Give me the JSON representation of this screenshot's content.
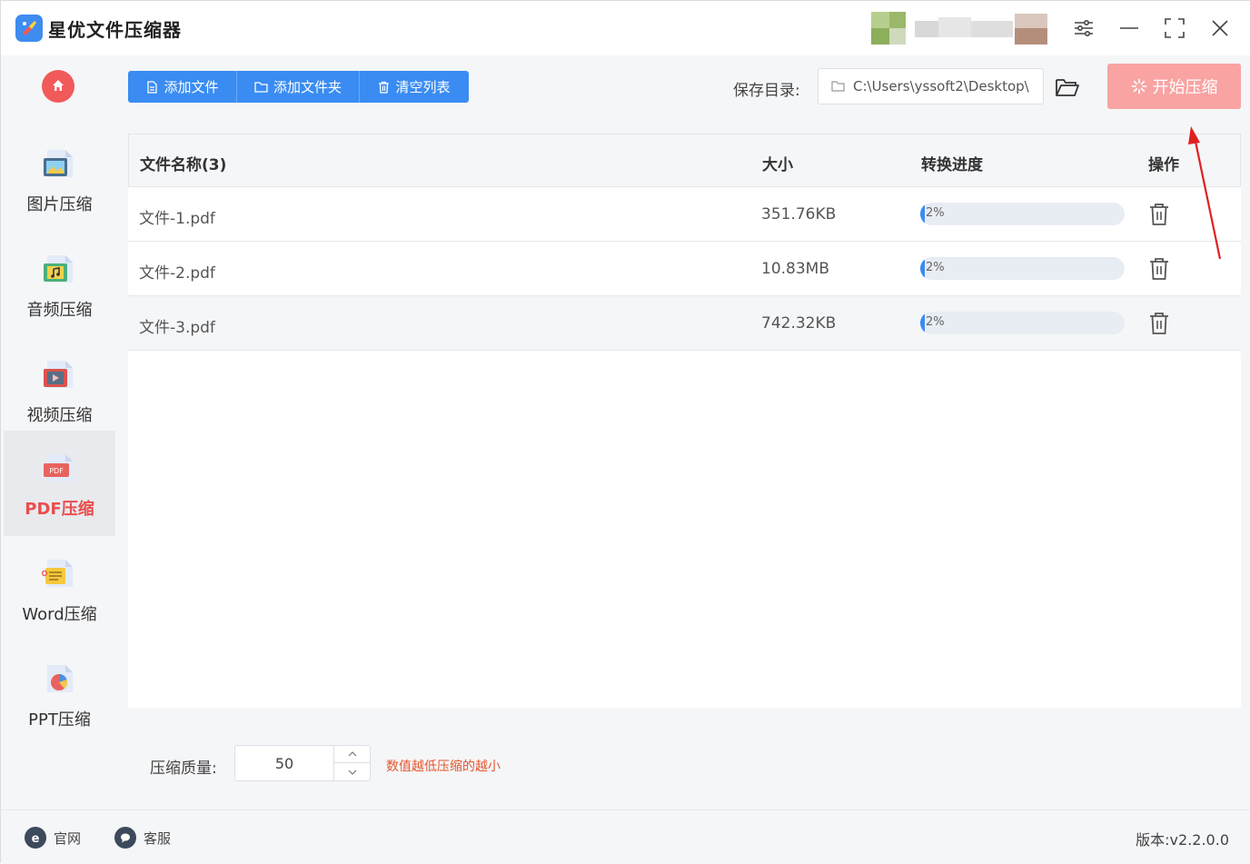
{
  "app": {
    "title": "星优文件压缩器"
  },
  "colors": {
    "accent": "#3a8cf2",
    "active": "#e94e4e",
    "start_button": "#f9a3a3",
    "hint": "#e4572e"
  },
  "sidebar": {
    "items": [
      {
        "label": "图片压缩",
        "icon": "image-file-icon",
        "active": false
      },
      {
        "label": "音频压缩",
        "icon": "audio-file-icon",
        "active": false
      },
      {
        "label": "视频压缩",
        "icon": "video-file-icon",
        "active": false
      },
      {
        "label": "PDF压缩",
        "icon": "pdf-file-icon",
        "active": true
      },
      {
        "label": "Word压缩",
        "icon": "word-file-icon",
        "active": false
      },
      {
        "label": "PPT压缩",
        "icon": "ppt-file-icon",
        "active": false
      }
    ]
  },
  "toolbar": {
    "add_file": "添加文件",
    "add_folder": "添加文件夹",
    "clear_list": "清空列表",
    "save_dir_label": "保存目录:",
    "save_dir_value": "C:\\Users\\yssoft2\\Desktop\\",
    "start": "开始压缩"
  },
  "table": {
    "headers": {
      "name": "文件名称(3)",
      "size": "大小",
      "progress": "转换进度",
      "action": "操作"
    },
    "rows": [
      {
        "name": "文件-1.pdf",
        "size": "351.76KB",
        "progress": 2,
        "progress_label": "2%"
      },
      {
        "name": "文件-2.pdf",
        "size": "10.83MB",
        "progress": 2,
        "progress_label": "2%"
      },
      {
        "name": "文件-3.pdf",
        "size": "742.32KB",
        "progress": 2,
        "progress_label": "2%"
      }
    ]
  },
  "settings": {
    "quality_label": "压缩质量:",
    "quality_value": "50",
    "hint": "数值越低压缩的越小"
  },
  "footer": {
    "website": "官网",
    "support": "客服",
    "version": "版本:v2.2.0.0"
  }
}
